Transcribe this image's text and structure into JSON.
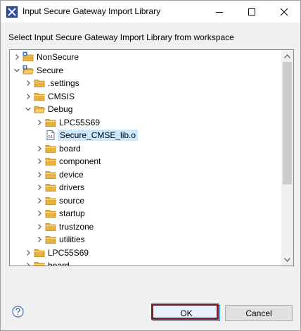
{
  "window": {
    "title": "Input Secure Gateway Import Library",
    "prompt": "Select Input Secure Gateway Import Library from workspace"
  },
  "tree": {
    "items": [
      {
        "label": "NonSecure",
        "depth": 0,
        "expanded": false,
        "kind": "project",
        "selected": false
      },
      {
        "label": "Secure",
        "depth": 0,
        "expanded": true,
        "kind": "project",
        "selected": false
      },
      {
        "label": ".settings",
        "depth": 1,
        "expanded": false,
        "kind": "folder",
        "selected": false
      },
      {
        "label": "CMSIS",
        "depth": 1,
        "expanded": false,
        "kind": "folder",
        "selected": false
      },
      {
        "label": "Debug",
        "depth": 1,
        "expanded": true,
        "kind": "folder",
        "selected": false
      },
      {
        "label": "LPC55S69",
        "depth": 2,
        "expanded": false,
        "kind": "folder",
        "selected": false
      },
      {
        "label": "Secure_CMSE_lib.o",
        "depth": 2,
        "expanded": null,
        "kind": "object-file",
        "selected": true
      },
      {
        "label": "board",
        "depth": 2,
        "expanded": false,
        "kind": "folder",
        "selected": false
      },
      {
        "label": "component",
        "depth": 2,
        "expanded": false,
        "kind": "folder",
        "selected": false
      },
      {
        "label": "device",
        "depth": 2,
        "expanded": false,
        "kind": "folder",
        "selected": false
      },
      {
        "label": "drivers",
        "depth": 2,
        "expanded": false,
        "kind": "folder",
        "selected": false
      },
      {
        "label": "source",
        "depth": 2,
        "expanded": false,
        "kind": "folder",
        "selected": false
      },
      {
        "label": "startup",
        "depth": 2,
        "expanded": false,
        "kind": "folder",
        "selected": false
      },
      {
        "label": "trustzone",
        "depth": 2,
        "expanded": false,
        "kind": "folder",
        "selected": false
      },
      {
        "label": "utilities",
        "depth": 2,
        "expanded": false,
        "kind": "folder",
        "selected": false
      },
      {
        "label": "LPC55S69",
        "depth": 1,
        "expanded": false,
        "kind": "folder",
        "selected": false
      },
      {
        "label": "board",
        "depth": 1,
        "expanded": false,
        "kind": "folder",
        "selected": false
      }
    ],
    "object_file_badge": "01"
  },
  "buttons": {
    "ok": "OK",
    "cancel": "Cancel"
  },
  "colors": {
    "selection": "#cce8ff",
    "folder": "#e8b23f",
    "project_badge": "#3d74c4",
    "ok_highlight": "#7a1f2b"
  },
  "icons": {
    "app": "secure-gateway-icon",
    "minimize": "minimize-icon",
    "maximize": "maximize-icon",
    "close": "close-icon",
    "help": "help-icon"
  }
}
